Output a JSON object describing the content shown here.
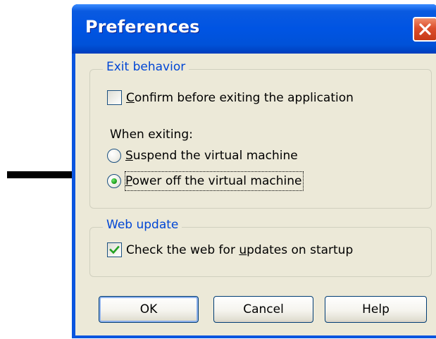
{
  "window": {
    "title": "Preferences"
  },
  "exit_behavior": {
    "legend": "Exit behavior",
    "confirm_checkbox": {
      "label_accel": "C",
      "label_rest": "onfirm before exiting the application",
      "checked": false
    },
    "when_exiting_label": "When exiting:",
    "options": [
      {
        "label_accel": "S",
        "label_rest": "uspend the virtual machine",
        "selected": false
      },
      {
        "label_accel": "P",
        "label_rest": "ower off the virtual machine",
        "selected": true
      }
    ]
  },
  "web_update": {
    "legend": "Web update",
    "check_updates": {
      "label_before": "Check the web for ",
      "label_accel": "u",
      "label_after": "pdates on startup",
      "checked": true
    }
  },
  "buttons": {
    "ok": "OK",
    "cancel": "Cancel",
    "help": "Help"
  },
  "colors": {
    "title_bar": "#0054e3",
    "client_background": "#ece9d8",
    "group_legend": "#0046d5",
    "close_button": "#dc4e2c",
    "checkmark": "#21a121",
    "arrow": "#000000"
  },
  "icons": {
    "close": "close-icon",
    "checkmark": "checkmark-icon",
    "arrow": "arrow-right-icon"
  }
}
